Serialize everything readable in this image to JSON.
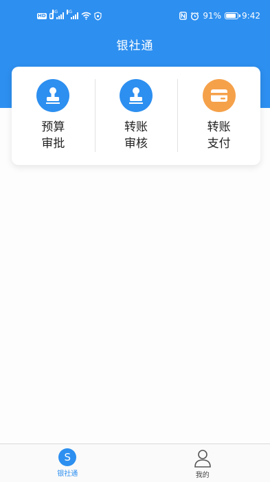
{
  "status_bar": {
    "battery": "91%",
    "time": "9:42",
    "network_tag_1": "4G",
    "network_tag_2": "4G"
  },
  "header": {
    "title": "银社通"
  },
  "functions": [
    {
      "line1": "预算",
      "line2": "审批",
      "icon": "stamp-icon",
      "color": "#2d8ff0"
    },
    {
      "line1": "转账",
      "line2": "审核",
      "icon": "stamp-icon",
      "color": "#2d8ff0"
    },
    {
      "line1": "转账",
      "line2": "支付",
      "icon": "card-icon",
      "color": "#f5a14a"
    }
  ],
  "tabbar": {
    "tabs": [
      {
        "label": "银社通",
        "icon_letter": "S",
        "active": true
      },
      {
        "label": "我的",
        "icon": "person-icon",
        "active": false
      }
    ]
  },
  "colors": {
    "primary": "#2d8ff0",
    "accent": "#f5a14a"
  }
}
